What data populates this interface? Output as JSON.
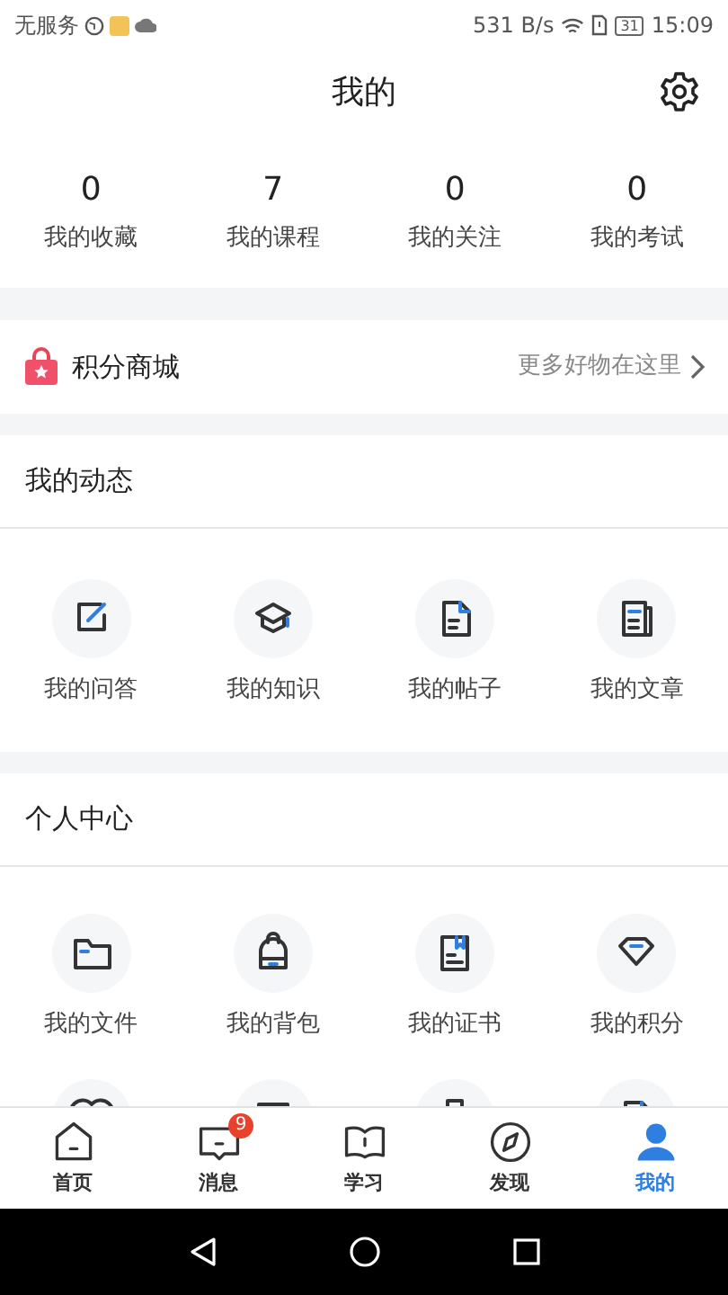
{
  "status_bar": {
    "carrier": "无服务",
    "speed": "531 B/s",
    "battery": "31",
    "time": "15:09"
  },
  "header": {
    "title": "我的"
  },
  "stats": [
    {
      "value": "0",
      "label": "我的收藏"
    },
    {
      "value": "7",
      "label": "我的课程"
    },
    {
      "value": "0",
      "label": "我的关注"
    },
    {
      "value": "0",
      "label": "我的考试"
    }
  ],
  "mall": {
    "title": "积分商城",
    "link": "更多好物在这里"
  },
  "sections": [
    {
      "title": "我的动态",
      "items": [
        {
          "kind": "edit",
          "label": "我的问答"
        },
        {
          "kind": "cap",
          "label": "我的知识"
        },
        {
          "kind": "doc",
          "label": "我的帖子"
        },
        {
          "kind": "article",
          "label": "我的文章"
        }
      ]
    },
    {
      "title": "个人中心",
      "items": [
        {
          "kind": "folder",
          "label": "我的文件"
        },
        {
          "kind": "bag",
          "label": "我的背包"
        },
        {
          "kind": "cert",
          "label": "我的证书"
        },
        {
          "kind": "gem",
          "label": "我的积分"
        },
        {
          "kind": "heart"
        },
        {
          "kind": "tablet"
        },
        {
          "kind": "phone"
        },
        {
          "kind": "doc"
        }
      ]
    }
  ],
  "tabs": [
    {
      "kind": "home",
      "label": "首页",
      "selected": false
    },
    {
      "kind": "message",
      "label": "消息",
      "selected": false,
      "badge": "9"
    },
    {
      "kind": "book",
      "label": "学习",
      "selected": false
    },
    {
      "kind": "compass",
      "label": "发现",
      "selected": false
    },
    {
      "kind": "user",
      "label": "我的",
      "selected": true
    }
  ]
}
